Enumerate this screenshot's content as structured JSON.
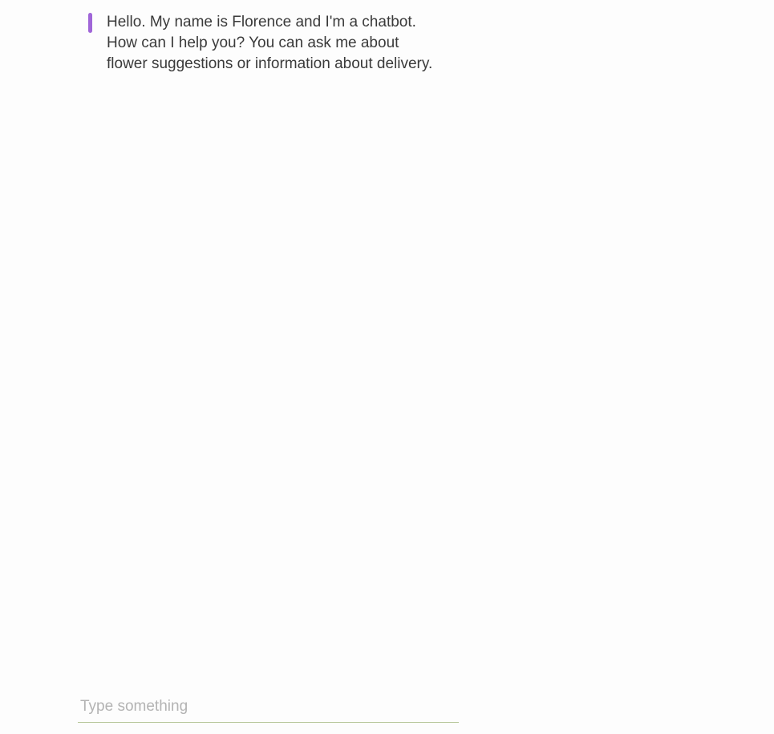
{
  "chat": {
    "messages": [
      {
        "sender": "bot",
        "text": "Hello. My name is Florence and I'm a chatbot. How can I help you? You can ask me about flower suggestions or information about delivery."
      }
    ]
  },
  "composer": {
    "value": "",
    "placeholder": "Type something"
  },
  "colors": {
    "bot_accent": "#a066d8",
    "input_underline": "#b7c79a",
    "text": "#3a3a3a",
    "placeholder": "#b3b3b3",
    "background": "#fdfdfd"
  }
}
